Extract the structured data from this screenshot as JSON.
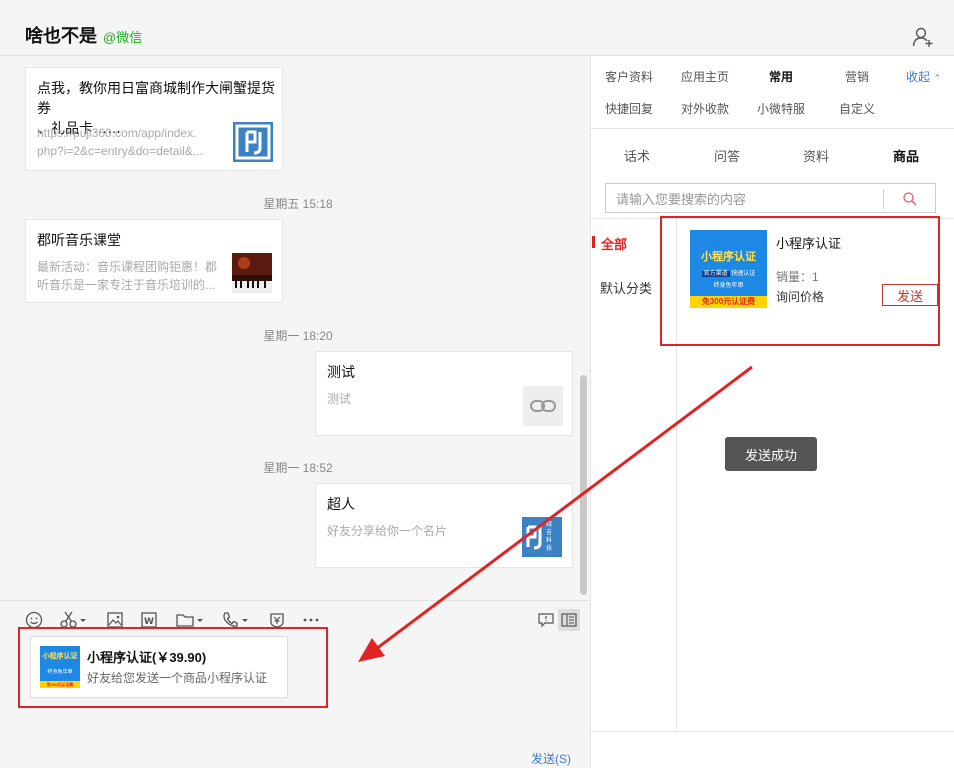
{
  "window": {
    "controls": [
      "—",
      "☐",
      "✕"
    ]
  },
  "header": {
    "title": "啥也不是",
    "tag": "@微信"
  },
  "chat": {
    "messages": [
      {
        "title": "点我，教你用日富商城制作大闸蟹提货券、礼品卡……",
        "title_line1": "点我，教你用日富商城制作大闸蟹提货券",
        "title_line2": "、礼品卡……",
        "desc_line1": "https://puji360.com/app/index.",
        "desc_line2": "php?i=2&c=entry&do=detail&..."
      },
      {
        "time": "星期五 15:18",
        "title": "郡听音乐课堂",
        "desc_line1": "最新活动：音乐课程团购钜惠！郡",
        "desc_line2": "听音乐是一家专注于音乐培训的..."
      },
      {
        "time": "星期一 18:20",
        "title": "测试",
        "desc_line1": "测试"
      },
      {
        "time": "星期一 18:52",
        "title": "超人",
        "desc_line1": "好友分享给你一个名片",
        "thumb_text": "晓吉科技"
      }
    ]
  },
  "composer": {
    "mini_card": {
      "title": "小程序认证(￥39.90)",
      "desc": "好友给您发送一个商品小程序认证"
    },
    "send_label": "发送(S)"
  },
  "right_panel": {
    "tabs_row1": [
      "客户资料",
      "应用主页",
      "常用",
      "营销"
    ],
    "collapse_label": "收起",
    "tabs_row2": [
      "快捷回复",
      "对外收款",
      "小微特服",
      "自定义"
    ],
    "subtabs": [
      "话术",
      "问答",
      "资料",
      "商品"
    ],
    "search_placeholder": "请输入您要搜索的内容",
    "categories": [
      "全部",
      "默认分类"
    ],
    "product": {
      "name": "小程序认证",
      "sales": "销量：1",
      "price": "询问价格",
      "send_label": "发送",
      "image_title": "小程序认证",
      "image_tag1": "官方渠道",
      "image_tag2": "快速认证",
      "image_tag3": "终身免年审",
      "image_bottom": "免300元认证费"
    },
    "toast": "发送成功"
  },
  "colors": {
    "highlight": "#e02424",
    "accent_green": "#1aad19",
    "link_blue": "#3d7dd8"
  }
}
